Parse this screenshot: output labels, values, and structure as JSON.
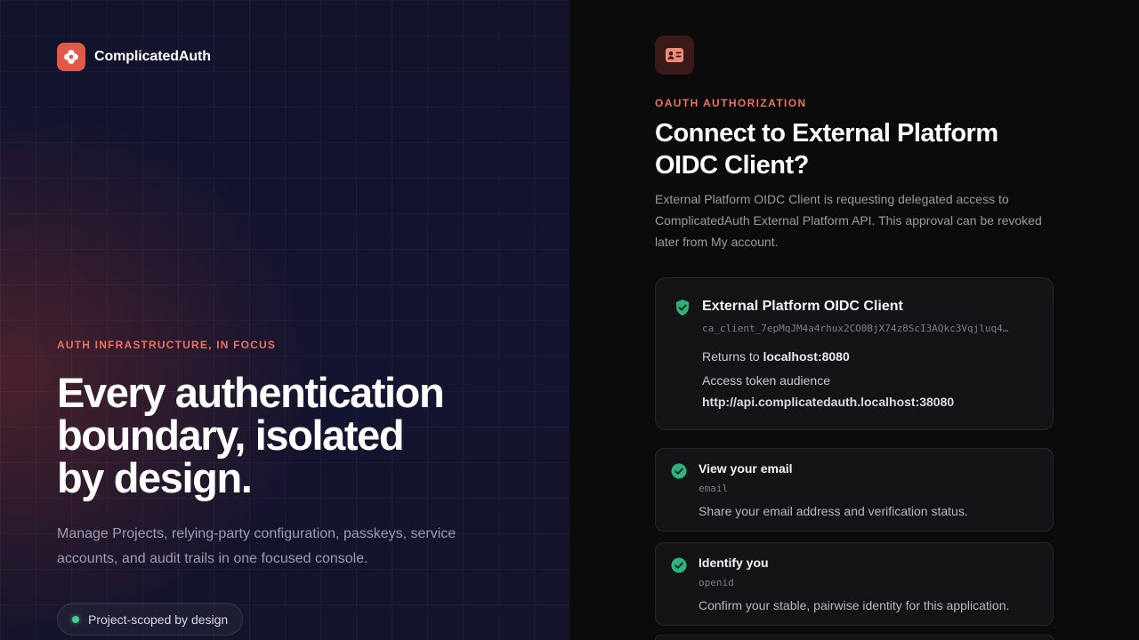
{
  "brand": {
    "name": "ComplicatedAuth",
    "color": "#e0594a"
  },
  "left": {
    "eyebrow": "AUTH INFRASTRUCTURE, IN FOCUS",
    "hero_lines": [
      "Every authentication",
      "boundary, isolated",
      "by design."
    ],
    "subtitle": "Manage Projects, relying-party configuration, passkeys, service accounts, and audit trails in one focused console.",
    "pill": {
      "label": "Project-scoped by design",
      "status_color": "#3ecf8e"
    }
  },
  "consent": {
    "icon": "id-card-icon",
    "eyebrow": "OAUTH AUTHORIZATION",
    "title": "Connect to External Platform OIDC Client?",
    "description": "External Platform OIDC Client is requesting delegated access to ComplicatedAuth External Platform API. This approval can be revoked later from My account.",
    "client": {
      "name": "External Platform OIDC Client",
      "client_id": "ca_client_7epMqJM4a4rhux2CO0BjX74z8ScI3AQkc3Vqjluq4…",
      "returns_to_label": "Returns to",
      "returns_to_value": "localhost:8080",
      "audience_label": "Access token audience",
      "audience_value": "http://api.complicatedauth.localhost:38080"
    },
    "scopes": [
      {
        "title": "View your email",
        "key": "email",
        "description": "Share your email address and verification status."
      },
      {
        "title": "Identify you",
        "key": "openid",
        "description": "Confirm your stable, pairwise identity for this application."
      }
    ]
  },
  "colors": {
    "accent": "#e8735f",
    "success": "#3ecf8e"
  }
}
